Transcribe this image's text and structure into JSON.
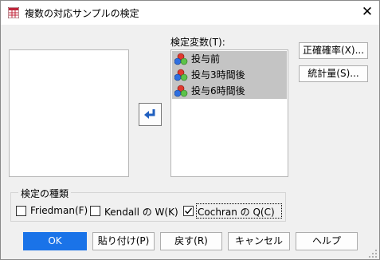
{
  "window": {
    "title": "複数の対応サンプルの検定",
    "close_glyph": "✕"
  },
  "target": {
    "label": "検定変数(T):",
    "items": [
      "投与前",
      "投与3時間後",
      "投与6時間後"
    ]
  },
  "move_button": {
    "icon": "return-arrow-icon"
  },
  "side_buttons": {
    "exact": "正確確率(X)...",
    "statistics": "統計量(S)..."
  },
  "test_type": {
    "label": "検定の種類",
    "options": [
      {
        "label": "Friedman(F)",
        "checked": false
      },
      {
        "label": "Kendall の W(K)",
        "checked": false
      },
      {
        "label": "Cochran の Q(C)",
        "checked": true
      }
    ]
  },
  "buttons": {
    "ok": "OK",
    "paste": "貼り付け(P)",
    "reset": "戻す(R)",
    "cancel": "キャンセル",
    "help": "ヘルプ"
  },
  "colors": {
    "accent": "#1a73e8",
    "selection": "#c4c4c4",
    "dialog_bg": "#f0f0f0"
  }
}
